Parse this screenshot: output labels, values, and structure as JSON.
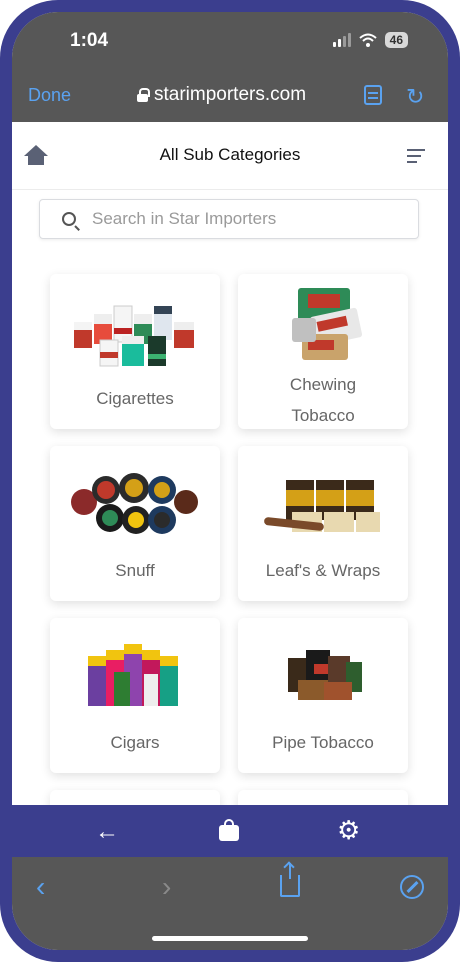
{
  "status": {
    "time": "1:04",
    "battery": "46"
  },
  "browser": {
    "done_label": "Done",
    "url": "starimporters.com"
  },
  "header": {
    "title": "All Sub Categories"
  },
  "search": {
    "placeholder": "Search in Star Importers"
  },
  "categories": [
    {
      "label": "Cigarettes"
    },
    {
      "label_line1": "Chewing",
      "label_line2": "Tobacco"
    },
    {
      "label": "Snuff"
    },
    {
      "label": "Leaf's & Wraps"
    },
    {
      "label": "Cigars"
    },
    {
      "label": "Pipe Tobacco"
    }
  ],
  "icons": {
    "home": "home-icon",
    "menu": "menu-icon",
    "search": "search-icon",
    "back": "arrow-left-icon",
    "cart": "shopping-bag-icon",
    "settings": "gear-icon",
    "share": "share-icon",
    "compass": "compass-icon"
  },
  "colors": {
    "brand": "#3b3e8e",
    "link": "#5aa2f0",
    "browser_chrome": "#575757"
  }
}
